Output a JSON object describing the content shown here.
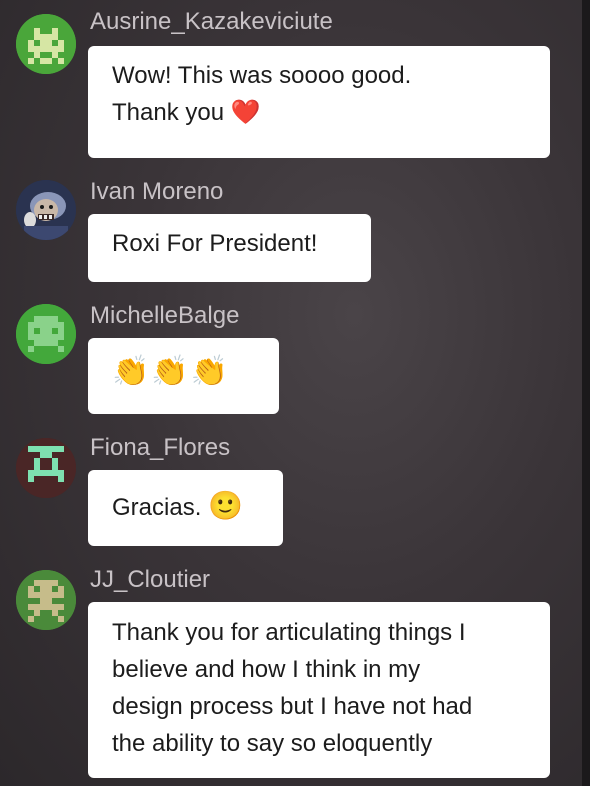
{
  "messages": [
    {
      "username": "Ausrine_Kazakeviciute",
      "text_line1": "Wow! This was soooo good.",
      "text_line2": "Thank you",
      "emoji": "❤️",
      "avatar_icon": "pixel-invader-green-avatar",
      "avatar_bg": "#4aa63a",
      "avatar_fg": "#d6e6a4"
    },
    {
      "username": "Ivan Moreno",
      "text": "Roxi For President!",
      "avatar_icon": "comic-character-photo-avatar",
      "avatar_bg": "#2a3350"
    },
    {
      "username": "MichelleBalge",
      "emoji": "👏👏👏",
      "avatar_icon": "pixel-invader-green-avatar",
      "avatar_bg": "#43a83b",
      "avatar_fg": "#8ad28a"
    },
    {
      "username": "Fiona_Flores",
      "text": "Gracias.",
      "emoji": "🙂",
      "avatar_icon": "pixel-glyph-dark-red-avatar",
      "avatar_bg": "#4a2626",
      "avatar_fg": "#7ee0b0"
    },
    {
      "username": "JJ_Cloutier",
      "text_lines": [
        "Thank you for articulating things I",
        "believe and how I think in my",
        "design process but I have not had",
        "the ability to say so eloquently"
      ],
      "avatar_icon": "pixel-invader-olive-avatar",
      "avatar_bg": "#4a8a3a",
      "avatar_fg": "#c6bc8a"
    }
  ]
}
